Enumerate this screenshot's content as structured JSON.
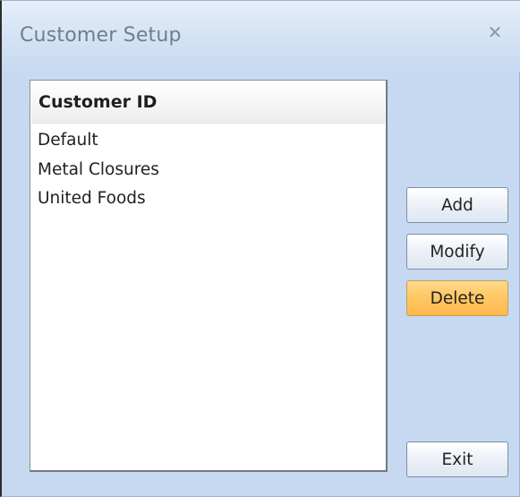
{
  "window": {
    "title": "Customer Setup",
    "close_glyph": "✕"
  },
  "list": {
    "header": "Customer ID",
    "items": [
      "Default",
      "Metal Closures",
      "United Foods"
    ]
  },
  "buttons": {
    "add": "Add",
    "modify": "Modify",
    "delete": "Delete",
    "exit": "Exit"
  },
  "colors": {
    "window_background": "#c6d9f1",
    "highlight_button": "#ffc866"
  },
  "icons": {
    "close": "close-icon"
  }
}
